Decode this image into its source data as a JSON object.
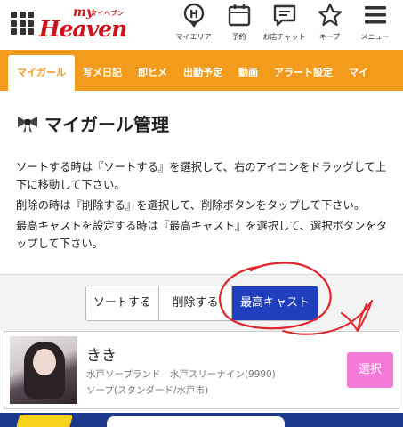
{
  "header": {
    "logo_my": "my",
    "logo_sub": "マイヘブン",
    "logo_main": "Heaven",
    "nav": [
      {
        "icon": "my-area-icon",
        "label": "マイエリア"
      },
      {
        "icon": "calendar-icon",
        "label": "予約"
      },
      {
        "icon": "chat-icon",
        "label": "お店チャット"
      },
      {
        "icon": "star-icon",
        "label": "キープ"
      },
      {
        "icon": "menu-icon",
        "label": "メニュー"
      }
    ]
  },
  "tabs": [
    "マイガール",
    "写メ日記",
    "即ヒメ",
    "出勤予定",
    "動画",
    "アラート設定",
    "マイ"
  ],
  "page": {
    "title": "マイガール管理",
    "instructions": [
      "ソートする時は『ソートする』を選択して、右のアイコンをドラッグして上下に移動して下さい。",
      "削除の時は『削除する』を選択して、削除ボタンをタップして下さい。",
      "最高キャストを設定する時は『最高キャスト』を選択して、選択ボタンをタップして下さい。"
    ]
  },
  "modes": {
    "sort": "ソートする",
    "delete": "削除する",
    "top_cast": "最高キャスト",
    "selected": "最高キャスト"
  },
  "cast": {
    "name": "きき",
    "shop": "水戸ソープランド　水戸スリーナイン(9990)",
    "type": "ソープ(スタンダード/水戸市)",
    "select_label": "選択"
  },
  "colors": {
    "accent_orange": "#f39b1c",
    "brand_red": "#d0121b",
    "selected_blue": "#1f3fbf",
    "select_pink": "#f37ad6",
    "annotation_red": "#e0262a"
  }
}
